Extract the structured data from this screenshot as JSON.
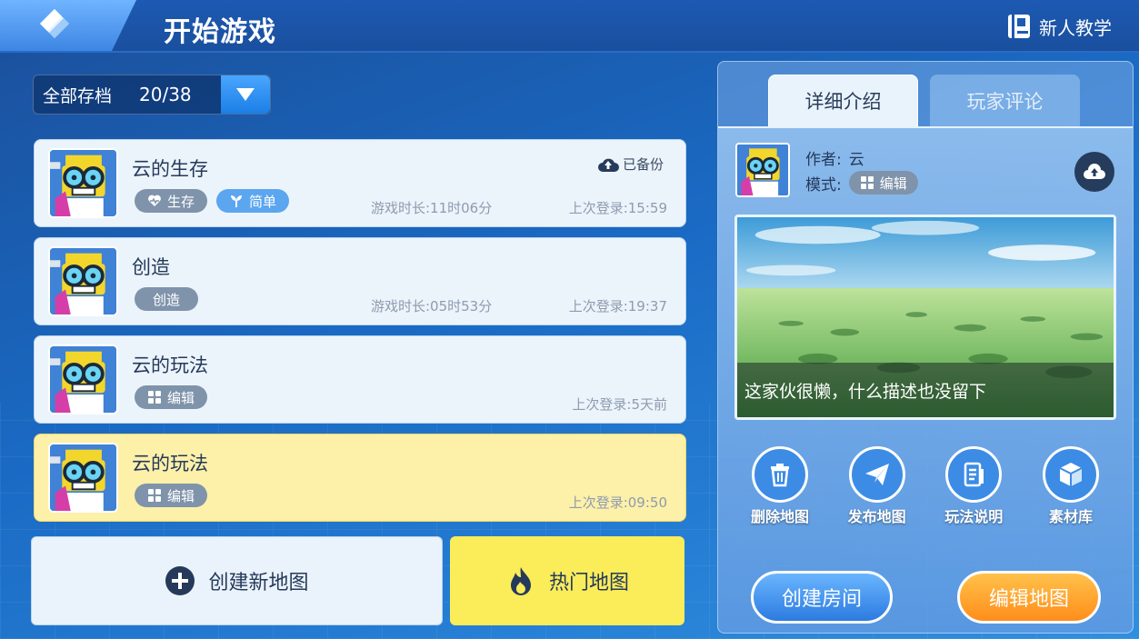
{
  "header": {
    "title": "开始游戏",
    "tutorial_label": "新人教学"
  },
  "archive": {
    "label": "全部存档",
    "count": "20/38"
  },
  "maps": [
    {
      "title": "云的生存",
      "tags": [
        {
          "label": "生存",
          "icon": "heart-pulse-icon"
        },
        {
          "label": "简单",
          "icon": "sprout-icon"
        }
      ],
      "play_time": "游戏时长:11时06分",
      "last_login": "上次登录:15:59",
      "status": "已备份"
    },
    {
      "title": "创造",
      "tags": [
        {
          "label": "创造",
          "icon": ""
        }
      ],
      "play_time": "游戏时长:05时53分",
      "last_login": "上次登录:19:37"
    },
    {
      "title": "云的玩法",
      "tags": [
        {
          "label": "编辑",
          "icon": "grid-icon"
        }
      ],
      "last_login": "上次登录:5天前"
    },
    {
      "title": "云的玩法",
      "tags": [
        {
          "label": "编辑",
          "icon": "grid-icon"
        }
      ],
      "last_login": "上次登录:09:50",
      "selected": true
    }
  ],
  "bottom": {
    "create_label": "创建新地图",
    "hot_label": "热门地图"
  },
  "panel": {
    "tabs": [
      "详细介绍",
      "玩家评论"
    ],
    "author_label": "作者:",
    "author_value": "云",
    "mode_label": "模式:",
    "mode_value": "编辑",
    "description": "这家伙很懒，什么描述也没留下",
    "actions": [
      "删除地图",
      "发布地图",
      "玩法说明",
      "素材库"
    ],
    "create_room_label": "创建房间",
    "edit_map_label": "编辑地图"
  },
  "colors": {
    "selected_card": "#fdf0a8",
    "hot_button": "#fbec5a",
    "edit_button": "#ff9d22",
    "accent_blue": "#3c8ce6"
  }
}
